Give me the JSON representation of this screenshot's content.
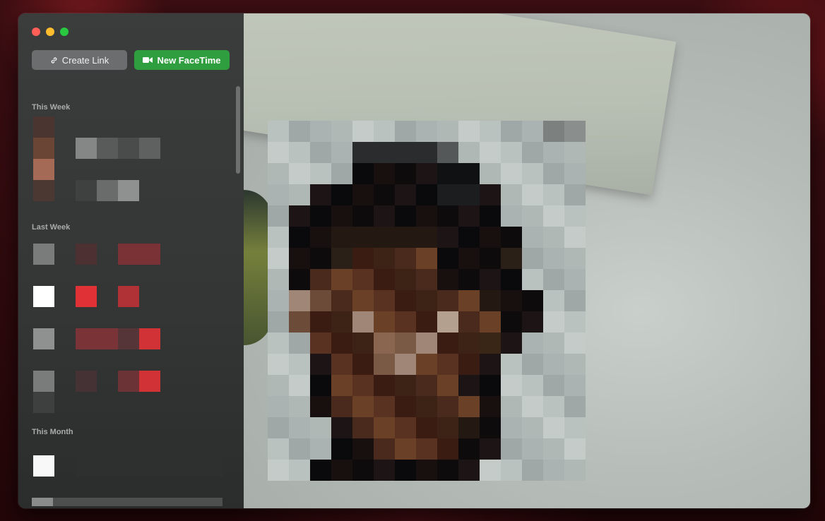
{
  "window": {
    "controls": [
      "close",
      "minimize",
      "zoom"
    ]
  },
  "toolbar": {
    "create_link_label": "Create Link",
    "create_link_icon": "link-icon",
    "new_facetime_label": "New FaceTime",
    "new_facetime_icon": "video-camera-icon"
  },
  "sections": {
    "this_week": "This Week",
    "last_week": "Last Week",
    "this_month": "This Month"
  },
  "colors": {
    "accent_green": "#2f9e3e",
    "close": "#ff5f57",
    "minimize": "#febc2e",
    "zoom": "#28c840"
  }
}
